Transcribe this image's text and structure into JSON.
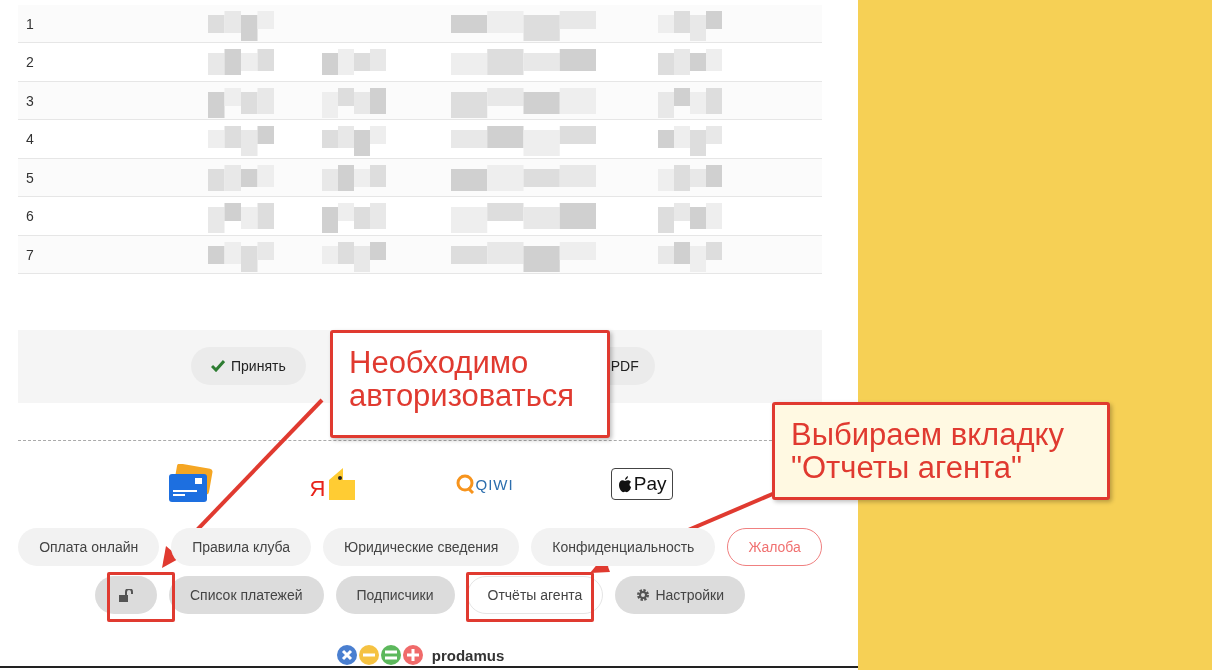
{
  "table": {
    "rows": [
      {
        "number": "1"
      },
      {
        "number": "2"
      },
      {
        "number": "3"
      },
      {
        "number": "4"
      },
      {
        "number": "5"
      },
      {
        "number": "6"
      },
      {
        "number": "7"
      }
    ]
  },
  "actions": [
    {
      "label": "Принять",
      "kind": "accept"
    },
    {
      "label": "PDF",
      "kind": "pdf"
    }
  ],
  "payment_methods": [
    {
      "kind": "card"
    },
    {
      "kind": "yandex",
      "mark": "Я"
    },
    {
      "kind": "qiwi",
      "mark": "QIWI"
    },
    {
      "kind": "applepay",
      "mark": "Pay"
    }
  ],
  "footer_rows": [
    [
      {
        "label": "Оплата онлайн",
        "kind": "grey"
      },
      {
        "label": "Правила клуба",
        "kind": "grey"
      },
      {
        "label": "Юридические сведения",
        "kind": "grey"
      },
      {
        "label": "Конфиденциальность",
        "kind": "grey"
      },
      {
        "label": "Жалоба",
        "kind": "danger"
      }
    ],
    [
      {
        "kind": "lock"
      },
      {
        "label": "Список платежей",
        "kind": "dark"
      },
      {
        "label": "Подписчики",
        "kind": "dark"
      },
      {
        "label": "Отчёты агента",
        "kind": "light"
      },
      {
        "label": "Настройки",
        "kind": "settings"
      }
    ]
  ],
  "brand": {
    "name": "prodamus"
  },
  "callouts": [
    {
      "text": "Необходимо авторизоваться",
      "kind": "white"
    },
    {
      "text": "Выбираем вкладку \"Отчеты агента\"",
      "kind": "cream"
    }
  ]
}
